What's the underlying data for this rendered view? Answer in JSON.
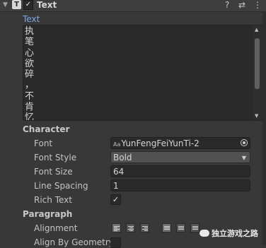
{
  "header": {
    "fold_glyph": "▼",
    "component_glyph": "T",
    "enabled_glyph": "✓",
    "title": "Text",
    "help_glyph": "?",
    "presets_glyph": "⇄",
    "menu_glyph": "⋮"
  },
  "text_field": {
    "label": "Text",
    "content": "执\n笔\n心\n欲\n碎\n，\n不\n肯\n忆"
  },
  "scrollbar": {
    "up_glyph": "▲",
    "down_glyph": "▼"
  },
  "character": {
    "title": "Character",
    "font": {
      "label": "Font",
      "icon_text": "Aa",
      "value": "YunFengFeiYunTi-2"
    },
    "font_style": {
      "label": "Font Style",
      "value": "Bold",
      "arrow": "▼"
    },
    "font_size": {
      "label": "Font Size",
      "value": "64"
    },
    "line_spacing": {
      "label": "Line Spacing",
      "value": "1"
    },
    "rich_text": {
      "label": "Rich Text",
      "check": "✓"
    }
  },
  "paragraph": {
    "title": "Paragraph",
    "alignment_label": "Alignment",
    "align_by_geometry_label": "Align By Geometry"
  },
  "watermark": {
    "text": "独立游戏之路"
  }
}
